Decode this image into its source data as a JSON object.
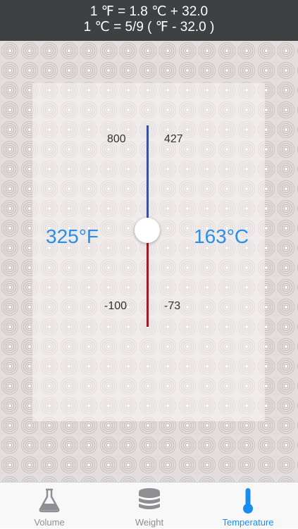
{
  "header": {
    "line1": "1 ℉ =  1.8 ℃ + 32.0",
    "line2": "1 ℃ = 5/9 ( ℉ - 32.0 )"
  },
  "scale": {
    "fahrenheit_max": "800",
    "celsius_max": "427",
    "fahrenheit_min": "-100",
    "celsius_min": "-73",
    "fahrenheit_reading": "325°F",
    "celsius_reading": "163°C"
  },
  "tabs": [
    {
      "label": "Volume",
      "icon": "flask-icon",
      "active": false
    },
    {
      "label": "Weight",
      "icon": "weight-stack-icon",
      "active": false
    },
    {
      "label": "Temperature",
      "icon": "thermometer-icon",
      "active": true
    }
  ],
  "colors": {
    "header_bg": "#3d4141",
    "reading_blue": "#2c8ee8",
    "scale_upper": "#3a4f9c",
    "scale_lower": "#9c1b24",
    "tab_active": "#1a8cf0",
    "tab_inactive": "#8e8e93"
  }
}
